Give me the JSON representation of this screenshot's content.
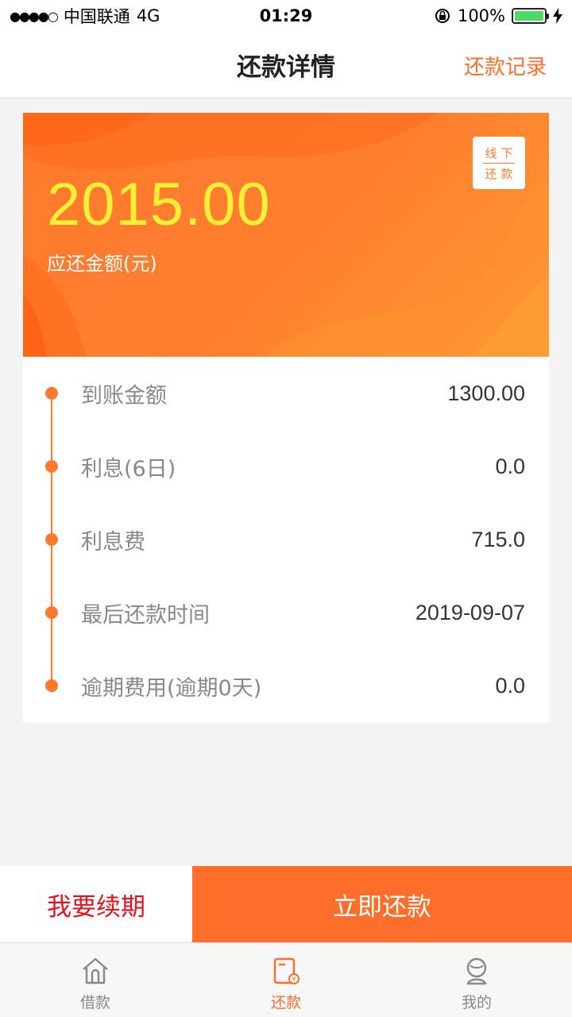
{
  "status_bar": {
    "signal": "●●●●○",
    "carrier": "中国联通",
    "network": "4G",
    "time": "01:29",
    "battery_pct": "100%",
    "battery_level": 1.0
  },
  "nav": {
    "title": "还款详情",
    "action": "还款记录"
  },
  "hero": {
    "amount": "2015.00",
    "amount_label": "应还金额(元)",
    "offline_line1": "线下",
    "offline_line2": "还款"
  },
  "details": [
    {
      "label": "到账金额",
      "value": "1300.00"
    },
    {
      "label": "利息(6日)",
      "value": "0.0"
    },
    {
      "label": "利息费",
      "value": "715.0"
    },
    {
      "label": "最后还款时间",
      "value": "2019-09-07"
    },
    {
      "label": "逾期费用(逾期0天)",
      "value": "0.0"
    }
  ],
  "actions": {
    "renew": "我要续期",
    "repay": "立即还款"
  },
  "tabs": [
    {
      "label": "借款",
      "icon": "home-icon",
      "active": false
    },
    {
      "label": "还款",
      "icon": "bill-icon",
      "active": true
    },
    {
      "label": "我的",
      "icon": "user-icon",
      "active": false
    }
  ],
  "colors": {
    "accent": "#ff6d2a",
    "amount": "#f8ef37",
    "renew": "#e8101b"
  }
}
